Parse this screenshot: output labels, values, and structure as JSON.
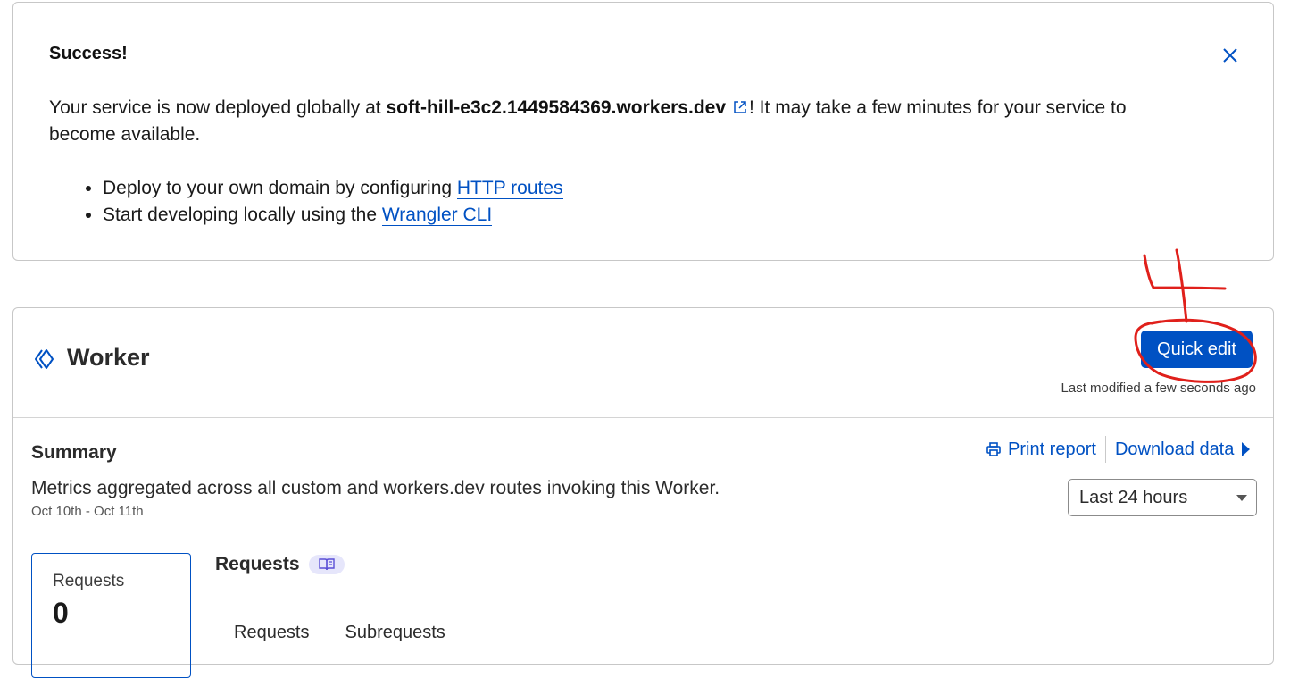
{
  "banner": {
    "title": "Success!",
    "message_prefix": "Your service is now deployed globally at ",
    "host": "soft-hill-e3c2.1449584369.workers.dev",
    "message_suffix": "! It may take a few minutes for your service to become available.",
    "bullets": [
      {
        "text": "Deploy to your own domain by configuring ",
        "link": "HTTP routes"
      },
      {
        "text": "Start developing locally using the ",
        "link": "Wrangler CLI"
      }
    ],
    "close_icon": "close-icon",
    "external_link_icon": "external-link-icon"
  },
  "worker": {
    "title": "Worker",
    "icon": "workers-icon",
    "quick_edit_label": "Quick edit",
    "last_modified": "Last modified a few seconds ago"
  },
  "summary": {
    "title": "Summary",
    "description": "Metrics aggregated across all custom and workers.dev routes invoking this Worker.",
    "date_range": "Oct 10th - Oct 11th",
    "print_label": "Print report",
    "download_label": "Download data",
    "time_range_selected": "Last 24 hours"
  },
  "metrics": {
    "requests_label": "Requests",
    "requests_value": "0"
  },
  "requests_panel": {
    "heading": "Requests",
    "tabs": [
      "Requests",
      "Subrequests"
    ]
  },
  "annotation": {
    "label": "4",
    "color": "#e0201b"
  },
  "colors": {
    "accent": "#0051c3",
    "border": "#c7c7c7"
  }
}
